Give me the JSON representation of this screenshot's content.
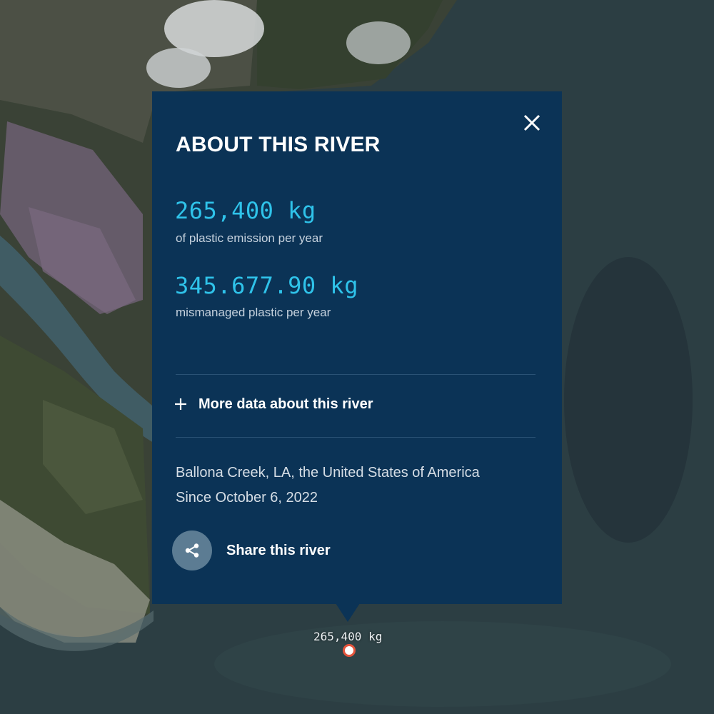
{
  "popup": {
    "title": "ABOUT THIS RIVER",
    "stats": [
      {
        "value": "265,400 kg",
        "label": "of plastic emission per year"
      },
      {
        "value": "345.677.90 kg",
        "label": "mismanaged plastic per year"
      }
    ],
    "more_data_label": "More data about this river",
    "location": "Ballona Creek, LA, the United States of America",
    "since": "Since October 6, 2022",
    "share_label": "Share this river",
    "icons": {
      "close": "close-icon",
      "more": "plus-icon",
      "share": "share-icon"
    }
  },
  "map_marker": {
    "label": "265,400 kg"
  },
  "colors": {
    "card_background": "#0b3356",
    "accent_value": "#2fc3ea",
    "share_button": "#5c7c93",
    "marker_ring": "#e4543c"
  }
}
